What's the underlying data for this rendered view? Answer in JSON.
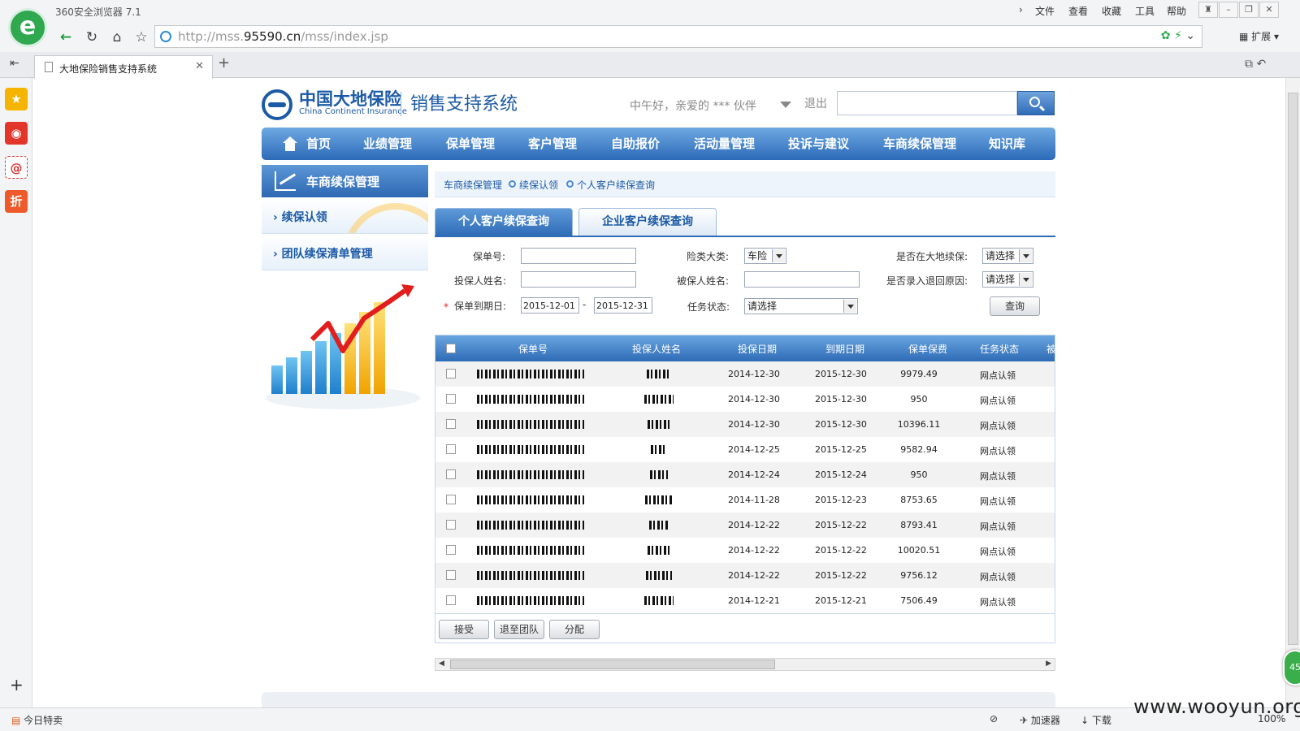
{
  "browser": {
    "name": "360安全浏览器 7.1",
    "menu": [
      "文件",
      "查看",
      "收藏",
      "工具",
      "帮助"
    ],
    "url_prefix": "http://mss.",
    "url_domain": "95590.cn",
    "url_path": "/mss/index.jsp",
    "extensions_label": "扩展",
    "tab_title": "大地保险销售支持系统",
    "status": {
      "daily_deals": "今日特卖",
      "accelerator": "加速器",
      "download": "下载",
      "zoom": "100%"
    },
    "float_badge": "45",
    "watermark": "www.wooyun.org"
  },
  "site": {
    "company_name": "中国大地保险",
    "company_name_en": "China Continent Insurance",
    "system_name": "销售支持系统",
    "greeting": "中午好，亲爱的 *** 伙伴",
    "logout": "退出",
    "search_placeholder": ""
  },
  "nav": [
    "首页",
    "业绩管理",
    "保单管理",
    "客户管理",
    "自助报价",
    "活动量管理",
    "投诉与建议",
    "车商续保管理",
    "知识库"
  ],
  "left_panel": {
    "title": "车商续保管理",
    "items": [
      "续保认领",
      "团队续保清单管理"
    ]
  },
  "breadcrumb": [
    "车商续保管理",
    "续保认领",
    "个人客户续保查询"
  ],
  "tabs": [
    "个人客户续保查询",
    "企业客户续保查询"
  ],
  "form": {
    "policy_no_label": "保单号:",
    "insurance_type_label": "险类大类:",
    "insurance_type_value": "车险",
    "renewed_label": "是否在大地续保:",
    "renewed_value": "请选择",
    "applicant_label": "投保人姓名:",
    "insured_label": "被保人姓名:",
    "return_reason_label": "是否录入退回原因:",
    "return_reason_value": "请选择",
    "required_mark": "*",
    "expiry_label": "保单到期日:",
    "expiry_from": "2015-12-01",
    "expiry_sep": "-",
    "expiry_to": "2015-12-31",
    "task_status_label": "任务状态:",
    "task_status_value": "请选择",
    "query_button": "查询"
  },
  "table": {
    "columns": [
      "保单号",
      "投保人姓名",
      "投保日期",
      "到期日期",
      "保单保费",
      "任务状态",
      "被"
    ],
    "rows": [
      {
        "start": "2014-12-30",
        "end": "2015-12-30",
        "premium": "9979.49",
        "status": "网点认领"
      },
      {
        "start": "2014-12-30",
        "end": "2015-12-30",
        "premium": "950",
        "status": "网点认领"
      },
      {
        "start": "2014-12-30",
        "end": "2015-12-30",
        "premium": "10396.11",
        "status": "网点认领"
      },
      {
        "start": "2014-12-25",
        "end": "2015-12-25",
        "premium": "9582.94",
        "status": "网点认领"
      },
      {
        "start": "2014-12-24",
        "end": "2015-12-24",
        "premium": "950",
        "status": "网点认领"
      },
      {
        "start": "2014-11-28",
        "end": "2015-12-23",
        "premium": "8753.65",
        "status": "网点认领"
      },
      {
        "start": "2014-12-22",
        "end": "2015-12-22",
        "premium": "8793.41",
        "status": "网点认领"
      },
      {
        "start": "2014-12-22",
        "end": "2015-12-22",
        "premium": "10020.51",
        "status": "网点认领"
      },
      {
        "start": "2014-12-22",
        "end": "2015-12-22",
        "premium": "9756.12",
        "status": "网点认领"
      },
      {
        "start": "2014-12-21",
        "end": "2015-12-21",
        "premium": "7506.49",
        "status": "网点认领"
      }
    ],
    "actions": [
      "接受",
      "退至团队",
      "分配"
    ]
  },
  "colors": {
    "brand_blue": "#1c5aa6",
    "nav_blue": "#2c6ab8",
    "browser_green": "#2fa84f"
  }
}
